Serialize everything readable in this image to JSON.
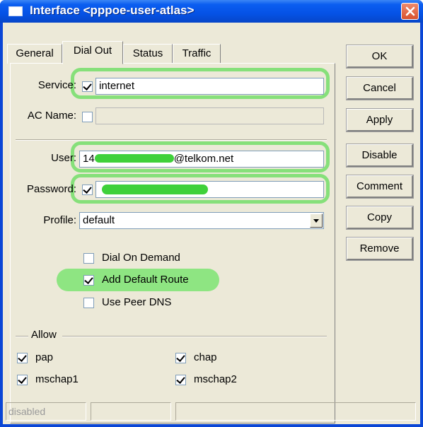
{
  "window": {
    "title": "Interface <pppoe-user-atlas>"
  },
  "tabs": [
    {
      "label": "General"
    },
    {
      "label": "Dial Out"
    },
    {
      "label": "Status"
    },
    {
      "label": "Traffic"
    }
  ],
  "form": {
    "service": {
      "label": "Service:",
      "checked": true,
      "value": "internet"
    },
    "ac_name": {
      "label": "AC Name:",
      "checked": false,
      "value": ""
    },
    "user": {
      "label": "User:",
      "value_prefix": "14",
      "value_suffix": "@telkom.net"
    },
    "password": {
      "label": "Password:",
      "checked": true
    },
    "profile": {
      "label": "Profile:",
      "value": "default"
    },
    "options": [
      {
        "label": "Dial On Demand",
        "checked": false
      },
      {
        "label": "Add Default Route",
        "checked": true
      },
      {
        "label": "Use Peer DNS",
        "checked": false
      }
    ],
    "allow": {
      "label": "Allow",
      "items": [
        {
          "label": "pap",
          "checked": true
        },
        {
          "label": "chap",
          "checked": true
        },
        {
          "label": "mschap1",
          "checked": true
        },
        {
          "label": "mschap2",
          "checked": true
        }
      ]
    }
  },
  "buttons": {
    "ok": "OK",
    "cancel": "Cancel",
    "apply": "Apply",
    "disable": "Disable",
    "comment": "Comment",
    "copy": "Copy",
    "remove": "Remove"
  },
  "statusbar": {
    "state": "disabled",
    "cell2": "",
    "cell3": ""
  },
  "colors": {
    "titlebar": "#0552e6",
    "highlight": "#86e07a",
    "dialog_bg": "#ece9d8"
  }
}
